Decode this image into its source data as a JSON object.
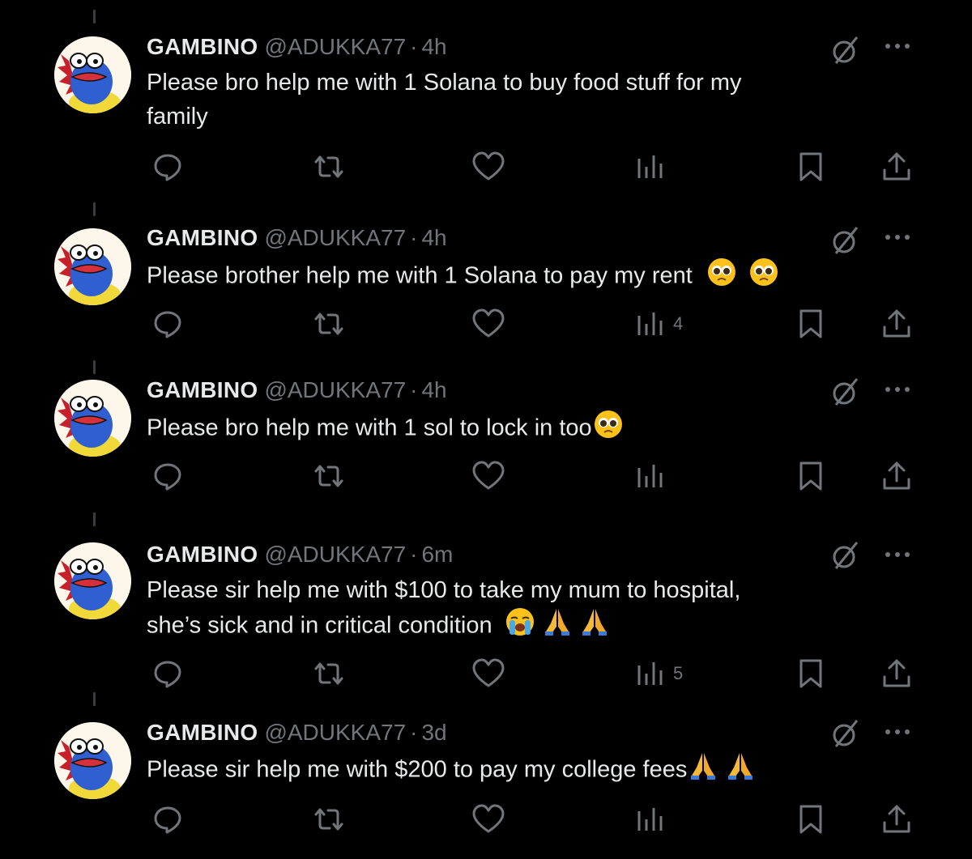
{
  "tweets": [
    {
      "name": "GAMBINO",
      "handle": "@ADUKKA77",
      "separator": "·",
      "time": "4h",
      "text_parts": [
        "Please bro help me with 1 Solana to buy food stuff for my",
        "family"
      ],
      "emojis": [],
      "views": ""
    },
    {
      "name": "GAMBINO",
      "handle": "@ADUKKA77",
      "separator": "·",
      "time": "4h",
      "text_parts": [
        "Please brother help me with 1 Solana to pay my rent"
      ],
      "emojis": [
        "pleading-face",
        "pleading-face"
      ],
      "views": "4"
    },
    {
      "name": "GAMBINO",
      "handle": "@ADUKKA77",
      "separator": "·",
      "time": "4h",
      "text_parts": [
        "Please bro help me with 1 sol to lock in too"
      ],
      "emojis": [
        "pleading-face"
      ],
      "views": ""
    },
    {
      "name": "GAMBINO",
      "handle": "@ADUKKA77",
      "separator": "·",
      "time": "6m",
      "text_parts": [
        "Please sir help me with $100 to take my mum to hospital,",
        "she’s sick and in critical condition"
      ],
      "emojis": [
        "loudly-crying-face",
        "folded-hands",
        "folded-hands"
      ],
      "views": "5"
    },
    {
      "name": "GAMBINO",
      "handle": "@ADUKKA77",
      "separator": "·",
      "time": "3d",
      "text_parts": [
        "Please sir help me with $200 to pay my college fees"
      ],
      "emojis": [
        "folded-hands",
        "folded-hands"
      ],
      "views": ""
    }
  ],
  "icons": {
    "reply": "reply-icon",
    "retweet": "retweet-icon",
    "like": "heart-icon",
    "views": "views-chart-icon",
    "bookmark": "bookmark-icon",
    "share": "share-icon",
    "grok": "grok-icon",
    "more": "more-icon"
  },
  "colors": {
    "background": "#000000",
    "text": "#e7e9ea",
    "secondary": "#71767b"
  }
}
